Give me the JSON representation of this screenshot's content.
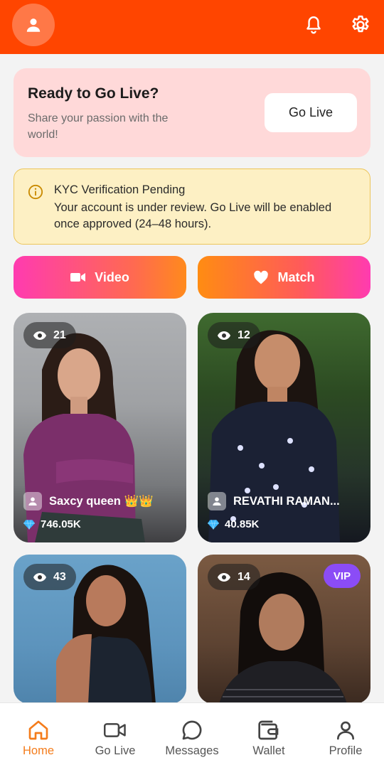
{
  "golive_card": {
    "title": "Ready to Go Live?",
    "subtitle": "Share your passion with the world!",
    "button": "Go Live"
  },
  "kyc": {
    "title": "KYC Verification Pending",
    "message": "Your account is under review. Go Live will be enabled once approved (24–48 hours)."
  },
  "actions": {
    "video": "Video",
    "match": "Match"
  },
  "streams": [
    {
      "viewers": "21",
      "name": "Saxcy queen 👑👑",
      "diamonds": "746.05K"
    },
    {
      "viewers": "12",
      "name": "REVATHI RAMAN...",
      "diamonds": "40.85K"
    },
    {
      "viewers": "43"
    },
    {
      "viewers": "14",
      "badge": "VIP"
    }
  ],
  "nav": {
    "home": "Home",
    "golive": "Go Live",
    "messages": "Messages",
    "wallet": "Wallet",
    "profile": "Profile"
  },
  "colors": {
    "brand": "#ff4500",
    "active_tab": "#f47c1b",
    "vip": "#8b4cf6"
  }
}
